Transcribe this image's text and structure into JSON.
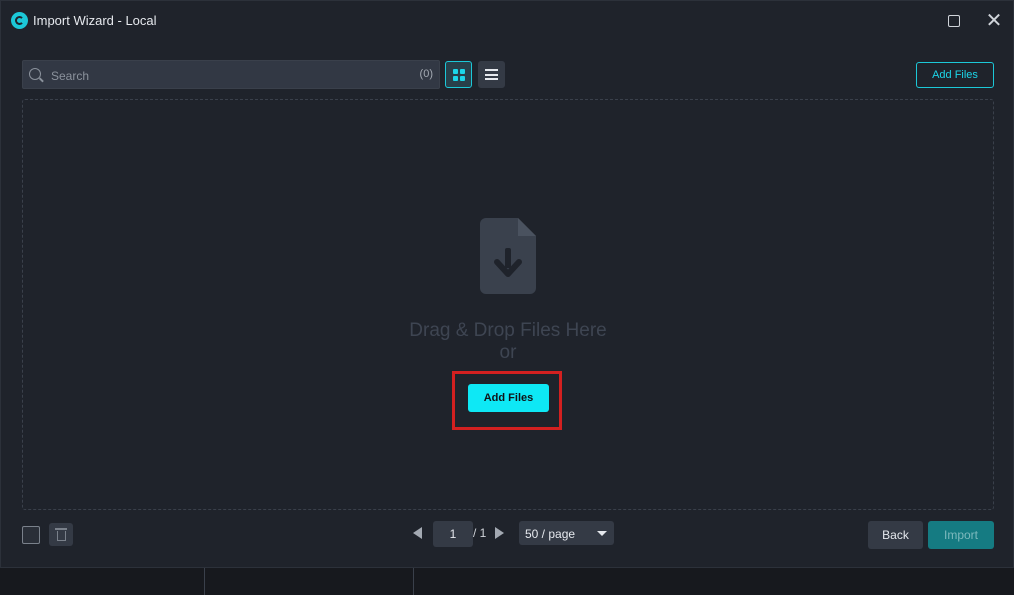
{
  "window": {
    "title": "Import Wizard - Local"
  },
  "search": {
    "placeholder": "Search",
    "count": "(0)"
  },
  "toolbar": {
    "add_files_label": "Add Files"
  },
  "dropzone": {
    "line1": "Drag & Drop Files Here",
    "line2": "or",
    "add_files_label": "Add Files"
  },
  "pagination": {
    "current_page": "1",
    "total": "/ 1",
    "page_size": "50 / page"
  },
  "footer": {
    "back_label": "Back",
    "import_label": "Import"
  },
  "colors": {
    "accent": "#0ee8f5",
    "background": "#1f232b",
    "highlight": "#d32020"
  },
  "icons": [
    "app-logo-icon",
    "maximize-icon",
    "close-icon",
    "search-icon",
    "grid-view-icon",
    "list-view-icon",
    "file-download-icon",
    "trash-icon",
    "prev-page-icon",
    "next-page-icon",
    "chevron-down-icon"
  ]
}
